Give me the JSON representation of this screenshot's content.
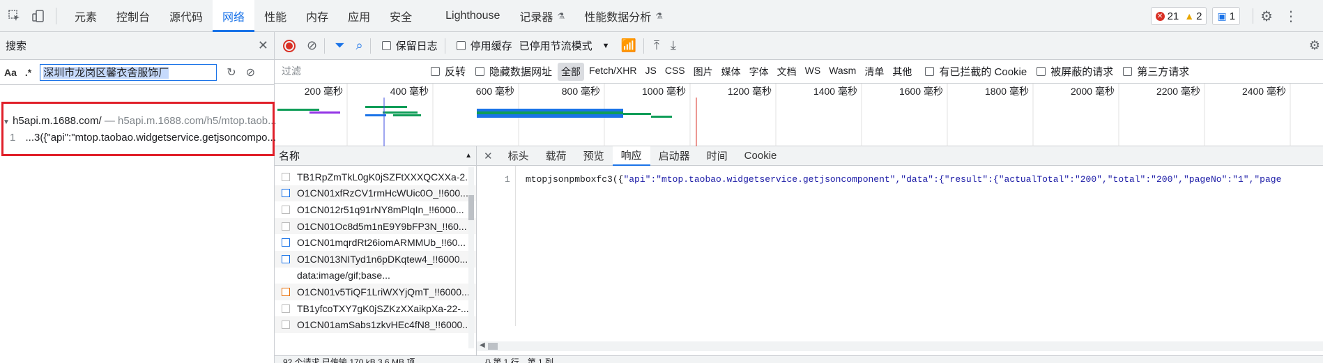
{
  "main_tabs": [
    {
      "label": "元素",
      "experimental": false
    },
    {
      "label": "控制台",
      "experimental": false
    },
    {
      "label": "源代码",
      "experimental": false
    },
    {
      "label": "网络",
      "experimental": false,
      "active": true
    },
    {
      "label": "性能",
      "experimental": false
    },
    {
      "label": "内存",
      "experimental": false
    },
    {
      "label": "应用",
      "experimental": false
    },
    {
      "label": "安全",
      "experimental": false
    },
    {
      "label": "Lighthouse",
      "experimental": false
    },
    {
      "label": "记录器",
      "experimental": true
    },
    {
      "label": "性能数据分析",
      "experimental": true
    }
  ],
  "top_right": {
    "errors": "21",
    "warnings": "2",
    "messages": "1"
  },
  "search": {
    "title": "搜索",
    "case_label": "Aa",
    "regex_label": ".*",
    "query": "深圳市龙岗区馨衣舍服饰厂"
  },
  "search_results": {
    "file_name": "h5api.m.1688.com/",
    "file_path": "h5api.m.1688.com/h5/mtop.taob...",
    "line_number": "1",
    "line_text": "...3({\"api\":\"mtop.taobao.widgetservice.getjsoncompo..."
  },
  "toolbar": {
    "preserve_log": "保留日志",
    "disable_cache": "停用缓存",
    "throttle": "已停用节流模式"
  },
  "filter": {
    "placeholder": "过滤",
    "invert": "反转",
    "hide_data_urls": "隐藏数据网址",
    "types": [
      "全部",
      "Fetch/XHR",
      "JS",
      "CSS",
      "图片",
      "媒体",
      "字体",
      "文档",
      "WS",
      "Wasm",
      "清单",
      "其他"
    ],
    "blocked_cookies": "有已拦截的 Cookie",
    "blocked_requests": "被屏蔽的请求",
    "third_party": "第三方请求"
  },
  "timeline": {
    "ticks": [
      "200 毫秒",
      "400 毫秒",
      "600 毫秒",
      "800 毫秒",
      "1000 毫秒",
      "1200 毫秒",
      "1400 毫秒",
      "1600 毫秒",
      "1800 毫秒",
      "2000 毫秒",
      "2200 毫秒",
      "2400 毫秒"
    ]
  },
  "request_list": {
    "header": "名称",
    "rows": [
      "TB1RpZmTkL0gK0jSZFtXXXQCXXa-2...",
      "O1CN01xfRzCV1rmHcWUic0O_!!600...",
      "O1CN012r51q91rNY8mPlqIn_!!6000...",
      "O1CN01Oc8d5m1nE9Y9bFP3N_!!60...",
      "O1CN01mqrdRt26iomARMMUb_!!60...",
      "O1CN013NITyd1n6pDKqtew4_!!6000...",
      "data:image/gif;base...",
      "O1CN01v5TiQF1LriWXYjQmT_!!6000...",
      "TB1yfcoTXY7gK0jSZKzXXaikpXa-22-...",
      "O1CN01amSabs1zkvHEc4fN8_!!6000..."
    ]
  },
  "detail": {
    "tabs": [
      "标头",
      "载荷",
      "预览",
      "响应",
      "启动器",
      "时间",
      "Cookie"
    ],
    "active_tab": "响应",
    "line_number": "1",
    "code_prefix": "mtopjsonpmboxfc3({",
    "code_body": "\"api\":\"mtop.taobao.widgetservice.getjsoncomponent\",\"data\":{\"result\":{\"actualTotal\":\"200\",\"total\":\"200\",\"pageNo\":\"1\",\"page"
  },
  "status": {
    "left": "92 个请求  已传输 170 kB  3.6 MB 项",
    "right": "{}  第 1 行，第 1 列"
  }
}
